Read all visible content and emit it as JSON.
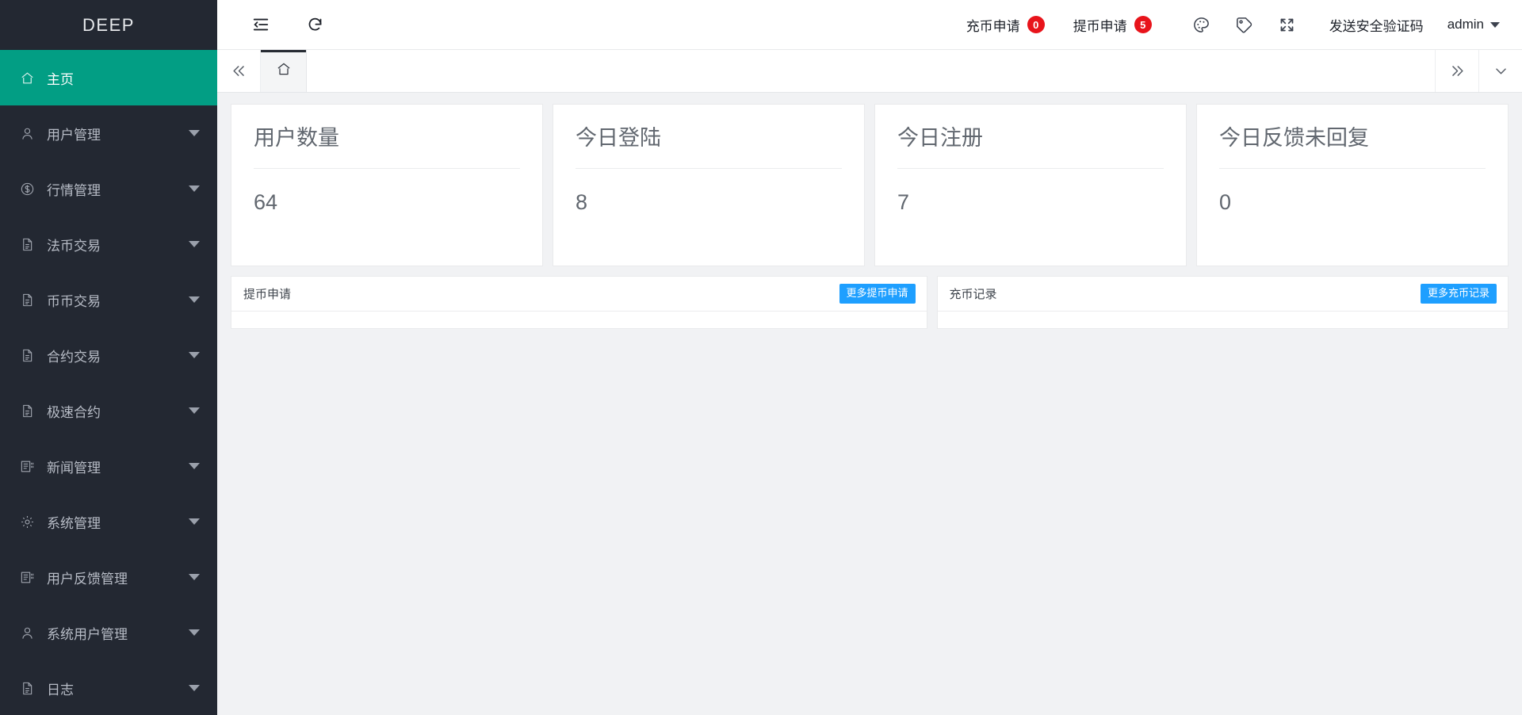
{
  "brand": {
    "name": "DEEP"
  },
  "sidebar": {
    "items": [
      {
        "label": "主页",
        "icon": "home-icon",
        "active": true,
        "caret": false
      },
      {
        "label": "用户管理",
        "icon": "user-icon",
        "active": false,
        "caret": true
      },
      {
        "label": "行情管理",
        "icon": "dollar-icon",
        "active": false,
        "caret": true
      },
      {
        "label": "法币交易",
        "icon": "document-icon",
        "active": false,
        "caret": true
      },
      {
        "label": "币币交易",
        "icon": "document-icon",
        "active": false,
        "caret": true
      },
      {
        "label": "合约交易",
        "icon": "document-icon",
        "active": false,
        "caret": true
      },
      {
        "label": "极速合约",
        "icon": "document-icon",
        "active": false,
        "caret": true
      },
      {
        "label": "新闻管理",
        "icon": "news-icon",
        "active": false,
        "caret": true
      },
      {
        "label": "系统管理",
        "icon": "gear-icon",
        "active": false,
        "caret": true
      },
      {
        "label": "用户反馈管理",
        "icon": "news-icon",
        "active": false,
        "caret": true
      },
      {
        "label": "系统用户管理",
        "icon": "user-icon",
        "active": false,
        "caret": true
      },
      {
        "label": "日志",
        "icon": "document-icon",
        "active": false,
        "caret": true
      }
    ]
  },
  "topbar": {
    "menu_toggle_icon": "menu-collapse-icon",
    "refresh_icon": "refresh-icon",
    "links": [
      {
        "label": "充币申请",
        "count": "0"
      },
      {
        "label": "提币申请",
        "count": "5"
      }
    ],
    "theme_icon": "palette-icon",
    "tag_icon": "tag-icon",
    "fullscreen_icon": "fullscreen-icon",
    "security_code_label": "发送安全验证码",
    "user": "admin"
  },
  "tabbar": {
    "prev_icon": "chevron-double-left-icon",
    "next_icon": "chevron-double-right-icon",
    "more_icon": "chevron-down-icon",
    "tabs": [
      {
        "label": "home-tab",
        "icon": "home-icon",
        "active": true
      }
    ]
  },
  "cards": [
    {
      "title": "用户数量",
      "value": "64"
    },
    {
      "title": "今日登陆",
      "value": "8"
    },
    {
      "title": "今日注册",
      "value": "7"
    },
    {
      "title": "今日反馈未回复",
      "value": "0"
    }
  ],
  "panels": [
    {
      "title": "提币申请",
      "button": "更多提币申请"
    },
    {
      "title": "充币记录",
      "button": "更多充币记录"
    }
  ],
  "colors": {
    "sidebar_bg": "#232832",
    "accent_green": "#029e84",
    "badge_red": "#e8141b",
    "button_blue": "#1e9fff"
  }
}
